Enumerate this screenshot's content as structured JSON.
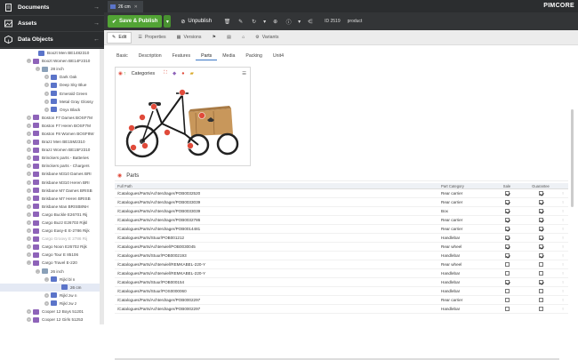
{
  "sidebar": {
    "sections": [
      {
        "label": "Documents"
      },
      {
        "label": "Assets"
      },
      {
        "label": "Data Objects"
      }
    ],
    "tree": [
      {
        "label": "Boozt Men BE1482310",
        "indent": 36,
        "type": "var",
        "toggle": "",
        "dim": false
      },
      {
        "label": "Boozt Women BE14F2310",
        "indent": 30,
        "type": "obj",
        "toggle": "-",
        "dim": false
      },
      {
        "label": "28 inch",
        "indent": 40,
        "type": "box",
        "toggle": "-",
        "dim": false
      },
      {
        "label": "Dark Oak",
        "indent": 50,
        "type": "var",
        "toggle": "+",
        "dim": false
      },
      {
        "label": "Deep Sky Blue",
        "indent": 50,
        "type": "var",
        "toggle": "+",
        "dim": false
      },
      {
        "label": "Emerald Green",
        "indent": 50,
        "type": "var",
        "toggle": "+",
        "dim": false
      },
      {
        "label": "Metal Gray Glossy",
        "indent": 50,
        "type": "var",
        "toggle": "+",
        "dim": false
      },
      {
        "label": "Onyx Black",
        "indent": 50,
        "type": "var",
        "toggle": "+",
        "dim": false
      },
      {
        "label": "Boston F7 Dames BOSF7M",
        "indent": 30,
        "type": "obj",
        "toggle": "+",
        "dim": false
      },
      {
        "label": "Boston F7 Heren BOSF7M",
        "indent": 30,
        "type": "obj",
        "toggle": "+",
        "dim": false
      },
      {
        "label": "Boston F8 Women BOSF8W",
        "indent": 30,
        "type": "obj",
        "toggle": "+",
        "dim": false
      },
      {
        "label": "Brazz Men BE15M2310",
        "indent": 30,
        "type": "obj",
        "toggle": "+",
        "dim": false
      },
      {
        "label": "Brazz Women BE15F2310",
        "indent": 30,
        "type": "obj",
        "toggle": "+",
        "dim": false
      },
      {
        "label": "Brinckers parts - Batteries",
        "indent": 30,
        "type": "obj",
        "toggle": "+",
        "dim": false
      },
      {
        "label": "Brinckers parts - Chargers",
        "indent": 30,
        "type": "obj",
        "toggle": "+",
        "dim": false
      },
      {
        "label": "Brisbane M310 Dames BRI",
        "indent": 30,
        "type": "obj",
        "toggle": "+",
        "dim": false
      },
      {
        "label": "Brisbane M310 Heren BRI",
        "indent": 30,
        "type": "obj",
        "toggle": "+",
        "dim": false
      },
      {
        "label": "Brisbane M7 Dames BRISB",
        "indent": 30,
        "type": "obj",
        "toggle": "+",
        "dim": false
      },
      {
        "label": "Brisbane M7 Heren BRISB",
        "indent": 30,
        "type": "obj",
        "toggle": "+",
        "dim": false
      },
      {
        "label": "Brisbane Man BRISB8NH",
        "indent": 30,
        "type": "obj",
        "toggle": "+",
        "dim": false
      },
      {
        "label": "Cargo Buckle E26701 Rij",
        "indent": 30,
        "type": "obj",
        "toggle": "+",
        "dim": false
      },
      {
        "label": "Cargo Buzz E26703 Rijkl",
        "indent": 30,
        "type": "obj",
        "toggle": "+",
        "dim": false
      },
      {
        "label": "Cargo Easy-E E-2786 Rijk",
        "indent": 30,
        "type": "obj",
        "toggle": "+",
        "dim": false
      },
      {
        "label": "Cargo Groovy E 2786 Rij",
        "indent": 30,
        "type": "obj",
        "toggle": "+",
        "dim": true
      },
      {
        "label": "Cargo Noon E26702 Rijk",
        "indent": 30,
        "type": "obj",
        "toggle": "+",
        "dim": false
      },
      {
        "label": "Cargo Tour E 85106",
        "indent": 30,
        "type": "obj",
        "toggle": "+",
        "dim": false
      },
      {
        "label": "Cargo Travel E-220",
        "indent": 30,
        "type": "obj",
        "toggle": "-",
        "dim": false
      },
      {
        "label": "26 inch",
        "indent": 40,
        "type": "box",
        "toggle": "-",
        "dim": false
      },
      {
        "label": "Rijkl bl n",
        "indent": 50,
        "type": "var",
        "toggle": "-",
        "dim": false
      },
      {
        "label": "26 cm",
        "indent": 62,
        "type": "var",
        "toggle": "",
        "dim": false,
        "selected": true
      },
      {
        "label": "Rijkl zw n",
        "indent": 50,
        "type": "var",
        "toggle": "+",
        "dim": false
      },
      {
        "label": "Rijkl zw z",
        "indent": 50,
        "type": "var",
        "toggle": "+",
        "dim": false
      },
      {
        "label": "Cooper 12 Boys 51201",
        "indent": 30,
        "type": "obj",
        "toggle": "+",
        "dim": false
      },
      {
        "label": "Cooper 12 Girls 51253",
        "indent": 30,
        "type": "obj",
        "toggle": "+",
        "dim": false
      }
    ]
  },
  "topbar": {
    "tab_title": "26 cm",
    "logo": "PIMCORE"
  },
  "toolbar": {
    "save_label": "Save & Publish",
    "unpublish_label": "Unpublish",
    "id_label": "ID 2519",
    "type_label": "product"
  },
  "objtabs": [
    {
      "label": "Edit",
      "active": true
    },
    {
      "label": "Properties",
      "active": false
    },
    {
      "label": "Versions",
      "active": false
    },
    {
      "label": "",
      "active": false
    },
    {
      "label": "",
      "active": false
    },
    {
      "label": "",
      "active": false
    },
    {
      "label": "Variants",
      "active": false
    }
  ],
  "subtabs": [
    {
      "label": "Basic",
      "active": false
    },
    {
      "label": "Description",
      "active": false
    },
    {
      "label": "Features",
      "active": false
    },
    {
      "label": "Parts",
      "active": true
    },
    {
      "label": "Media",
      "active": false
    },
    {
      "label": "Packing",
      "active": false
    },
    {
      "label": "Unit4",
      "active": false
    }
  ],
  "image_panel": {
    "label": "Categories"
  },
  "parts": {
    "title": "Parts",
    "columns": [
      "Full Path",
      "Part Category",
      "Sale",
      "Guarantee",
      ""
    ],
    "rows": [
      {
        "path": "/Catalogues/Parts/Achterdrager/POB0032520",
        "category": "Rear carrier",
        "sale": true,
        "guarantee": true
      },
      {
        "path": "/Catalogues/Parts/Achterdrager/POB0033039",
        "category": "Rear carrier",
        "sale": true,
        "guarantee": true
      },
      {
        "path": "/Catalogues/Parts/Achterdrager/POB0033039",
        "category": "Box",
        "sale": true,
        "guarantee": true
      },
      {
        "path": "/Catalogues/Parts/Achterdrager/POB0032786",
        "category": "Rear carrier",
        "sale": true,
        "guarantee": true
      },
      {
        "path": "/Catalogues/Parts/Achterdrager/POB0014481",
        "category": "Rear carrier",
        "sale": true,
        "guarantee": true
      },
      {
        "path": "/Catalogues/Parts/Stuur/POB001212",
        "category": "Handlebar",
        "sale": true,
        "guarantee": true
      },
      {
        "path": "/Catalogues/Parts/Achterwiel/POB0030045",
        "category": "Rear wheel",
        "sale": true,
        "guarantee": true
      },
      {
        "path": "/Catalogues/Parts/Stuur/POB0002193",
        "category": "Handlebar",
        "sale": true,
        "guarantee": true
      },
      {
        "path": "/Catalogues/Parts/Achterwiel/REMKABEL-220-Y",
        "category": "Rear wheel",
        "sale": false,
        "guarantee": false
      },
      {
        "path": "/Catalogues/Parts/Achterwiel/REMKABEL-220-Y",
        "category": "Handlebar",
        "sale": false,
        "guarantee": false
      },
      {
        "path": "/Catalogues/Parts/Stuur/POB000154",
        "category": "Handlebar",
        "sale": true,
        "guarantee": true
      },
      {
        "path": "/Catalogues/Parts/Stuur/POS0000060",
        "category": "Handlebar",
        "sale": false,
        "guarantee": false
      },
      {
        "path": "/Catalogues/Parts/Achterdrager/POB0002297",
        "category": "Rear carrier",
        "sale": false,
        "guarantee": false
      },
      {
        "path": "/Catalogues/Parts/Achterdrager/POB0002297",
        "category": "Handlebar",
        "sale": false,
        "guarantee": false
      }
    ]
  },
  "colors": {
    "accent_green": "#52a435",
    "hotspot_red": "#e04a3a",
    "sidebar_dark": "#2b2d2f"
  }
}
